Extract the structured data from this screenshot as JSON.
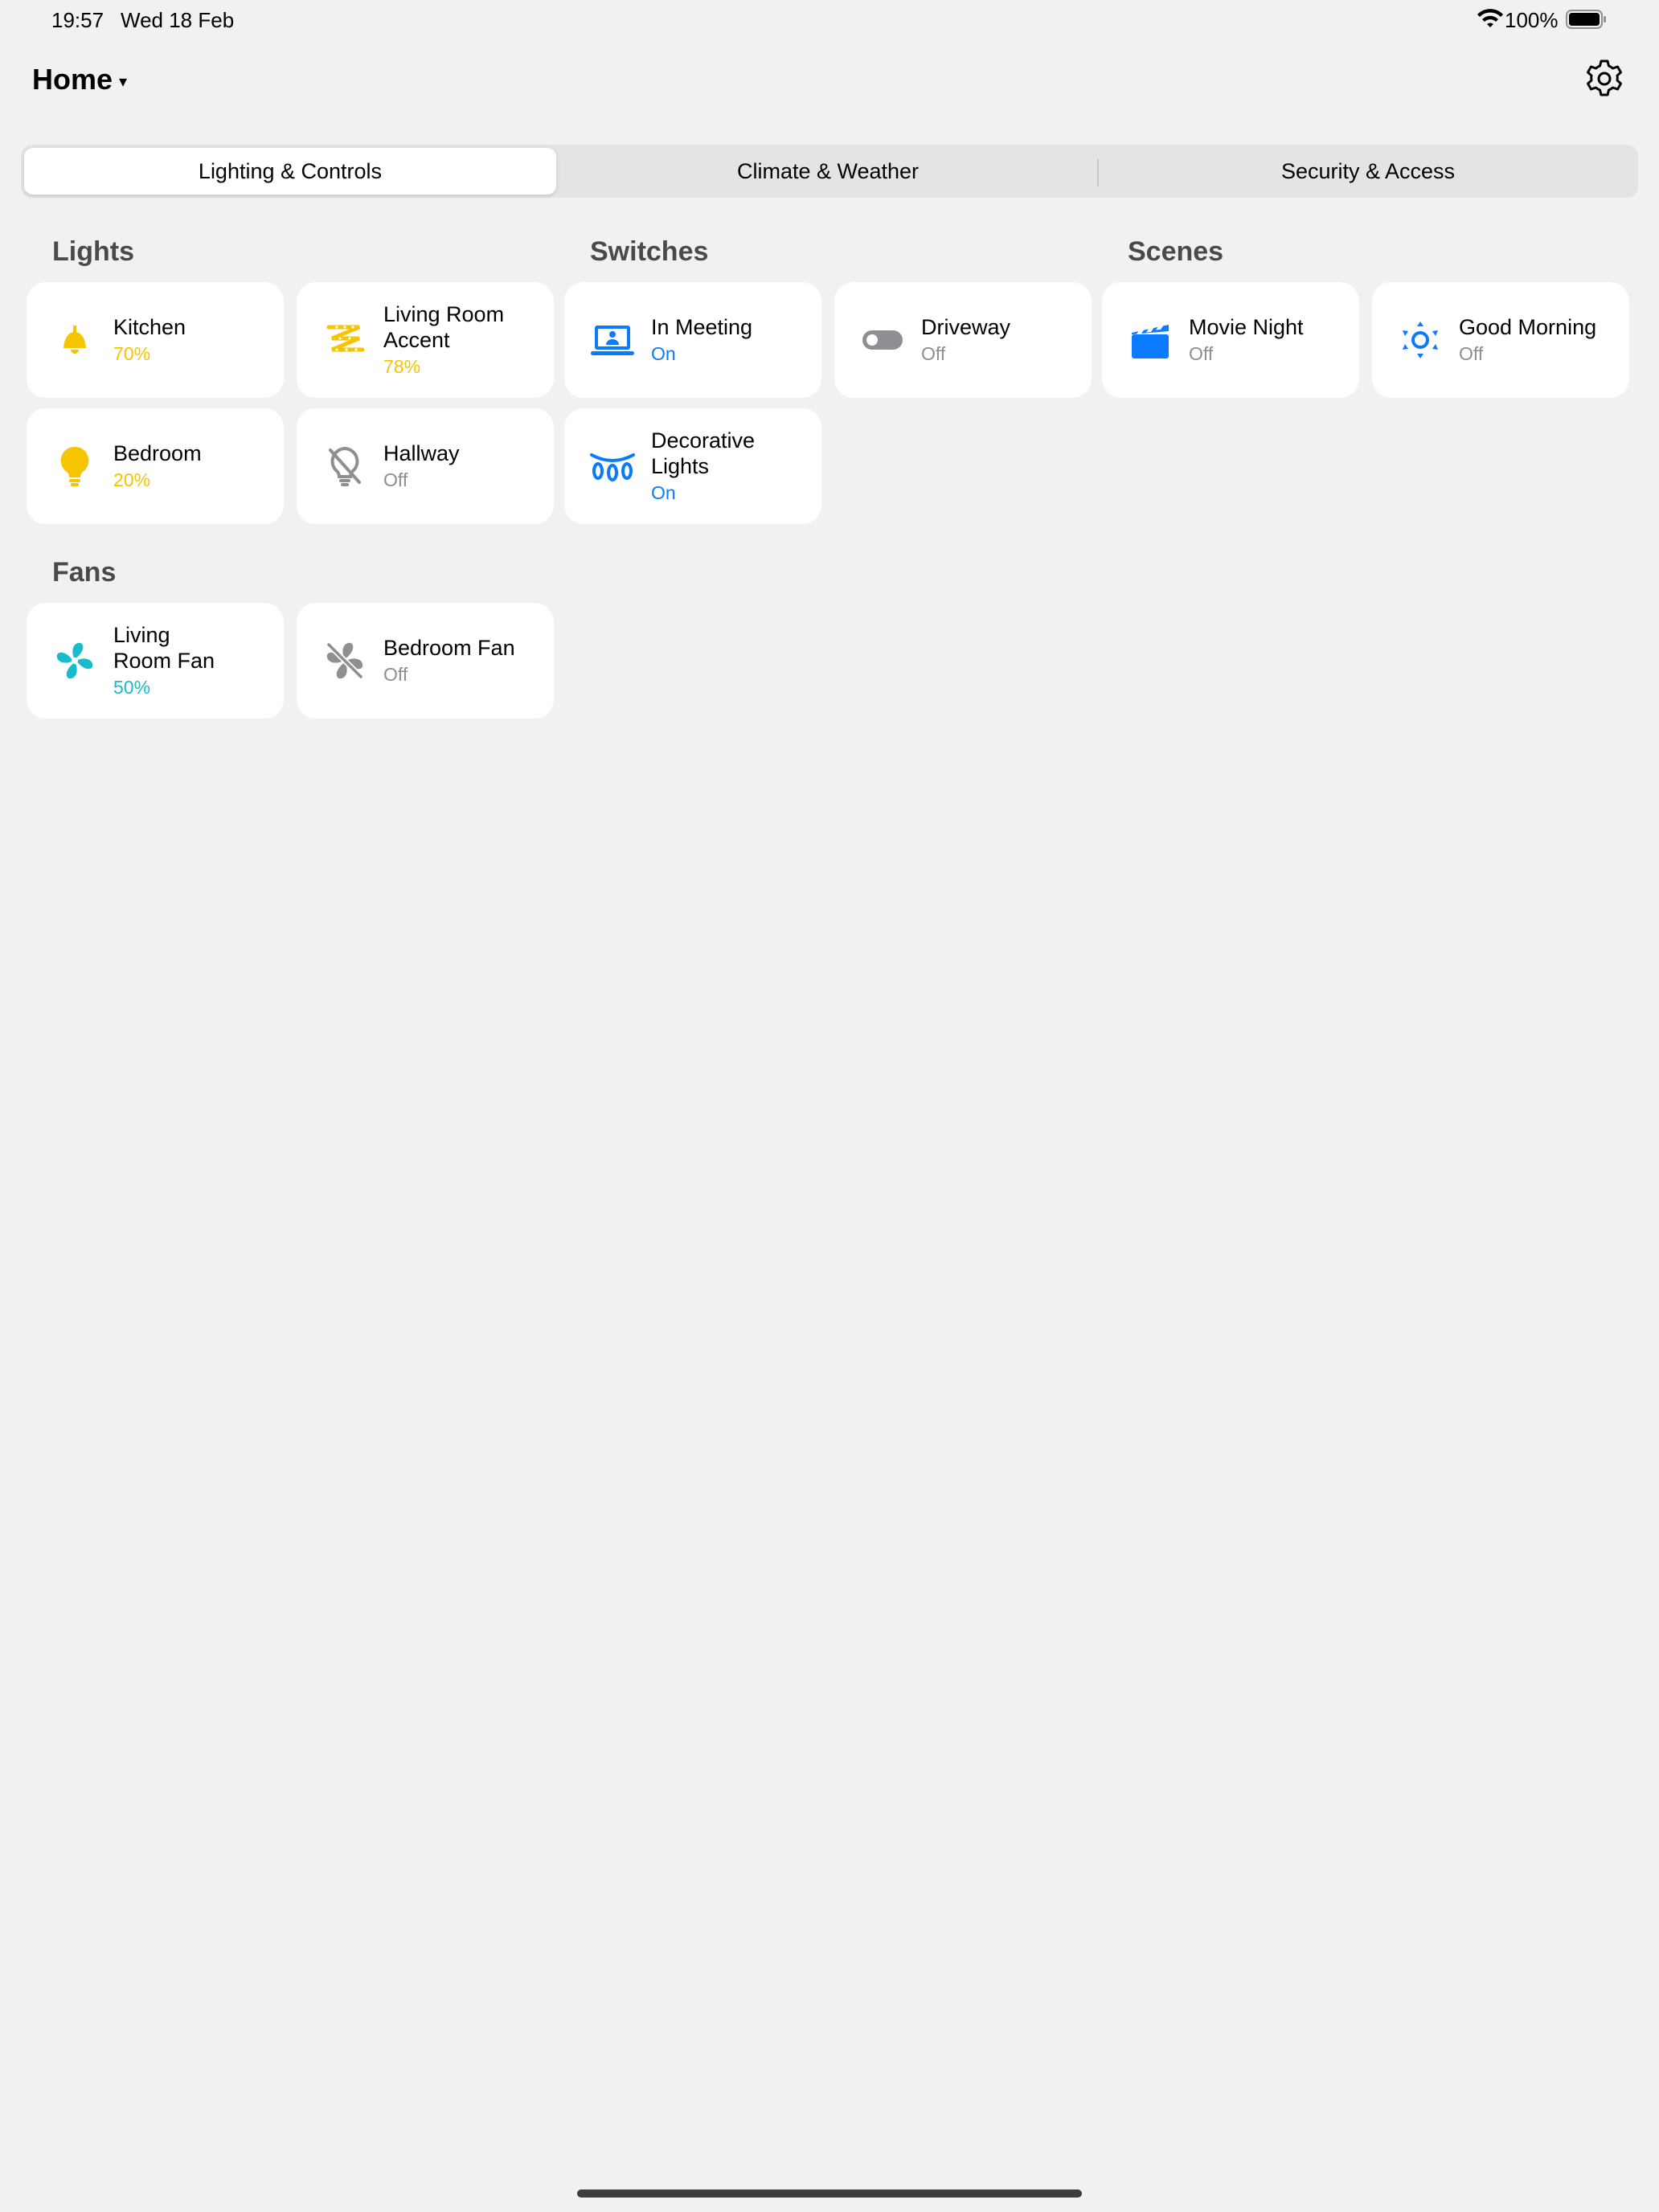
{
  "status_bar": {
    "time": "19:57",
    "date": "Wed 18 Feb",
    "battery_percent": "100%",
    "wifi_icon": "wifi-icon",
    "battery_icon": "battery-full-icon"
  },
  "header": {
    "title": "Home",
    "title_caret": "▾",
    "settings_icon": "gear-icon"
  },
  "tabs": [
    {
      "label": "Lighting & Controls",
      "active": true
    },
    {
      "label": "Climate & Weather",
      "active": false
    },
    {
      "label": "Security & Access",
      "active": false
    }
  ],
  "sections": {
    "lights": {
      "title": "Lights",
      "items": [
        {
          "name": "Kitchen",
          "state": "70%",
          "icon": "pendant-lamp-icon",
          "state_color": "#f6c400"
        },
        {
          "name": "Living Room Accent",
          "state": "78%",
          "icon": "light-strip-icon",
          "state_color": "#f6c400"
        },
        {
          "name": "Bedroom",
          "state": "20%",
          "icon": "lightbulb-icon",
          "state_color": "#f6c400"
        },
        {
          "name": "Hallway",
          "state": "Off",
          "icon": "lightbulb-off-icon",
          "state_color": "#8e8e93"
        }
      ]
    },
    "switches": {
      "title": "Switches",
      "items": [
        {
          "name": "In Meeting",
          "state": "On",
          "icon": "laptop-person-icon",
          "state_color": "#0a7aff"
        },
        {
          "name": "Driveway",
          "state": "Off",
          "icon": "toggle-switch-icon",
          "state_color": "#8e8e93"
        },
        {
          "name": "Decorative Lights",
          "state": "On",
          "icon": "string-lights-icon",
          "state_color": "#0a7aff"
        }
      ]
    },
    "scenes": {
      "title": "Scenes",
      "items": [
        {
          "name": "Movie Night",
          "state": "Off",
          "icon": "clapperboard-icon",
          "state_color": "#8e8e93"
        },
        {
          "name": "Good Morning",
          "state": "Off",
          "icon": "sunrise-icon",
          "state_color": "#8e8e93"
        }
      ]
    },
    "fans": {
      "title": "Fans",
      "items": [
        {
          "name": "Living Room Fan",
          "state": "50%",
          "icon": "fan-icon",
          "state_color": "#16bccb"
        },
        {
          "name": "Bedroom Fan",
          "state": "Off",
          "icon": "fan-off-icon",
          "state_color": "#8e8e93"
        }
      ]
    }
  },
  "colors": {
    "background": "#f1f1f2",
    "tile": "#ffffff",
    "accent_yellow": "#f6c400",
    "accent_blue": "#0a7aff",
    "accent_teal": "#16bccb",
    "muted": "#8e8e93"
  }
}
